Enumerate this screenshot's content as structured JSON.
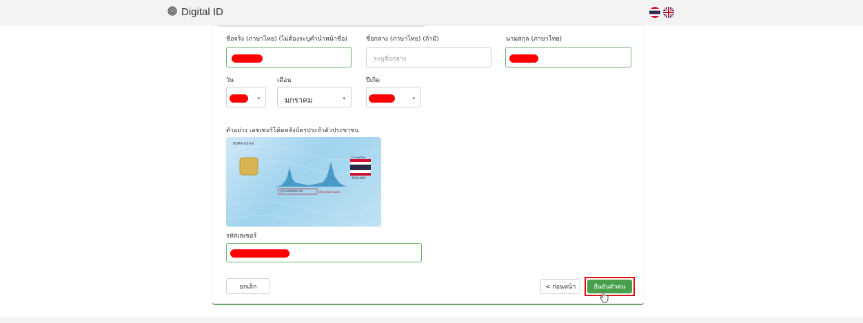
{
  "header": {
    "title": "Digital ID",
    "icon": "fingerprint-icon"
  },
  "languages": [
    {
      "name": "thai-flag-icon"
    },
    {
      "name": "uk-flag-icon"
    }
  ],
  "form": {
    "first_name_label": "ชื่อจริง (ภาษาไทย) (ไม่ต้องระบุคำนำหน้าชื่อ)",
    "middle_name_label": "ชื่อกลาง (ภาษาไทย) (ถ้ามี)",
    "middle_name_placeholder": "ระบุชื่อกลาง",
    "last_name_label": "นามสกุล (ภาษาไทย)",
    "day_label": "วัน",
    "month_label": "เดือน",
    "month_value": "มกราคม",
    "year_label": "ปีเกิด",
    "card_example_label": "ตัวอย่าง เลขเซอร์โค้ดหลังบัตรประจำตัวประชาชน",
    "laser_label": "รหัสเลเซอร์"
  },
  "id_card": {
    "top_code": "BORA-XX-XX",
    "laser_code": "JC0-0000000-00",
    "laser_caption": "รหัสเลเซอร์บนบัตร",
    "country_thai": "ประเทศไทย",
    "country_en": "THAILAND"
  },
  "actions": {
    "cancel": "ยกเลิก",
    "previous": "< ก่อนหน้า",
    "confirm": "ยืนยันตัวตน"
  },
  "colors": {
    "accent": "#4aa04a",
    "redaction": "#ff0000",
    "highlight": "#e01010"
  }
}
